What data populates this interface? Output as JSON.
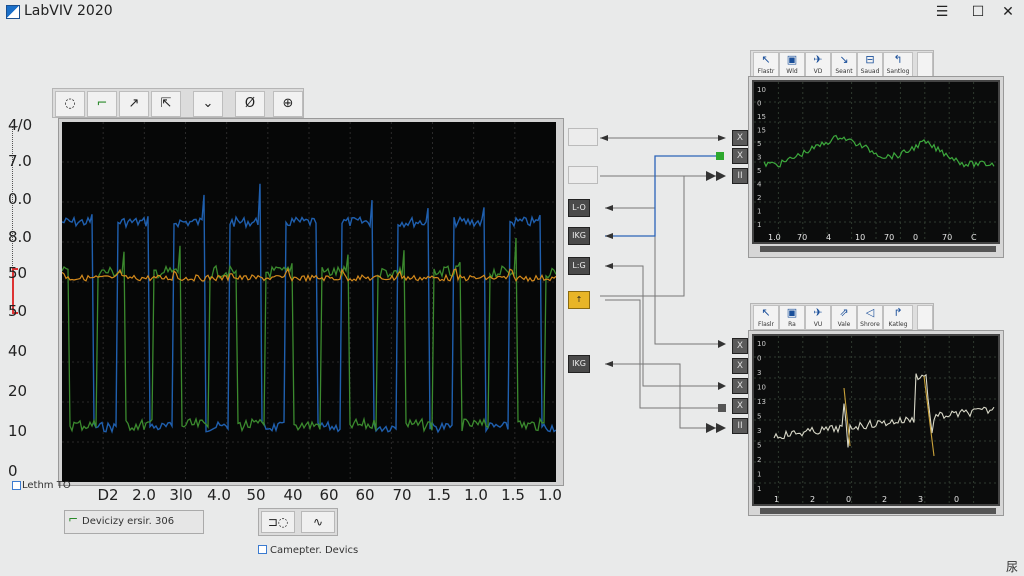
{
  "window": {
    "title": "LabVIV 2020",
    "controls": {
      "menu": "☰",
      "maximize": "☐",
      "close": "✕"
    }
  },
  "main_toolbar": {
    "tools": [
      "lasso-tool",
      "connect-tool",
      "pointer-tool",
      "cursor-tool",
      "dropdown-tool",
      "probe-tool",
      "zoom-tool"
    ]
  },
  "main_graph": {
    "y_ticks": [
      "4/0",
      "7.0",
      "0.0",
      "8.0",
      "50",
      "50",
      "40",
      "20",
      "10",
      "0"
    ],
    "x_ticks": [
      "D2",
      "2.0",
      "3l0",
      "4.0",
      "50",
      "40",
      "60",
      "60",
      "70",
      "1.5",
      "1.0",
      "1.5",
      "1.0"
    ],
    "legend_label": "Lethm TO",
    "colors": {
      "series_a": "#3b8a2e",
      "series_b": "#1f5fae",
      "series_c": "#d48a1c"
    }
  },
  "bottom": {
    "device_label": "Devicizy ersir.  306",
    "computer_label": "Camepter.  Devics"
  },
  "connectors": {
    "left_terms": [
      "L-O",
      "IKG",
      "L:G",
      "↑",
      "IKG"
    ]
  },
  "right_top": {
    "tools": [
      {
        "icon": "↖",
        "label": "Flastr"
      },
      {
        "icon": "▣",
        "label": "Wld"
      },
      {
        "icon": "✈",
        "label": "VD"
      },
      {
        "icon": "↘",
        "label": "Seant"
      },
      {
        "icon": "⊟",
        "label": "Sauad"
      },
      {
        "icon": "↰",
        "label": "Santlog"
      }
    ],
    "y_ticks": [
      "10",
      "0",
      "15",
      "15",
      "5",
      "3",
      "5",
      "4",
      "2",
      "1",
      "1"
    ],
    "x_ticks": [
      "1.0",
      "70",
      "4",
      "10",
      "70",
      "0",
      "70",
      "C"
    ]
  },
  "right_bottom": {
    "tools": [
      {
        "icon": "↖",
        "label": "Flaslr"
      },
      {
        "icon": "▣",
        "label": "Ra"
      },
      {
        "icon": "✈",
        "label": "VU"
      },
      {
        "icon": "⇗",
        "label": "Vale"
      },
      {
        "icon": "◁",
        "label": "Shrore"
      },
      {
        "icon": "↱",
        "label": "Katleg"
      }
    ],
    "y_ticks": [
      "10",
      "0",
      "3",
      "10",
      "13",
      "5",
      "3",
      "5",
      "2",
      "1",
      "1"
    ],
    "x_ticks": [
      "1",
      "2",
      "0",
      "2",
      "3",
      "0"
    ]
  },
  "corner_glyph": "尿"
}
